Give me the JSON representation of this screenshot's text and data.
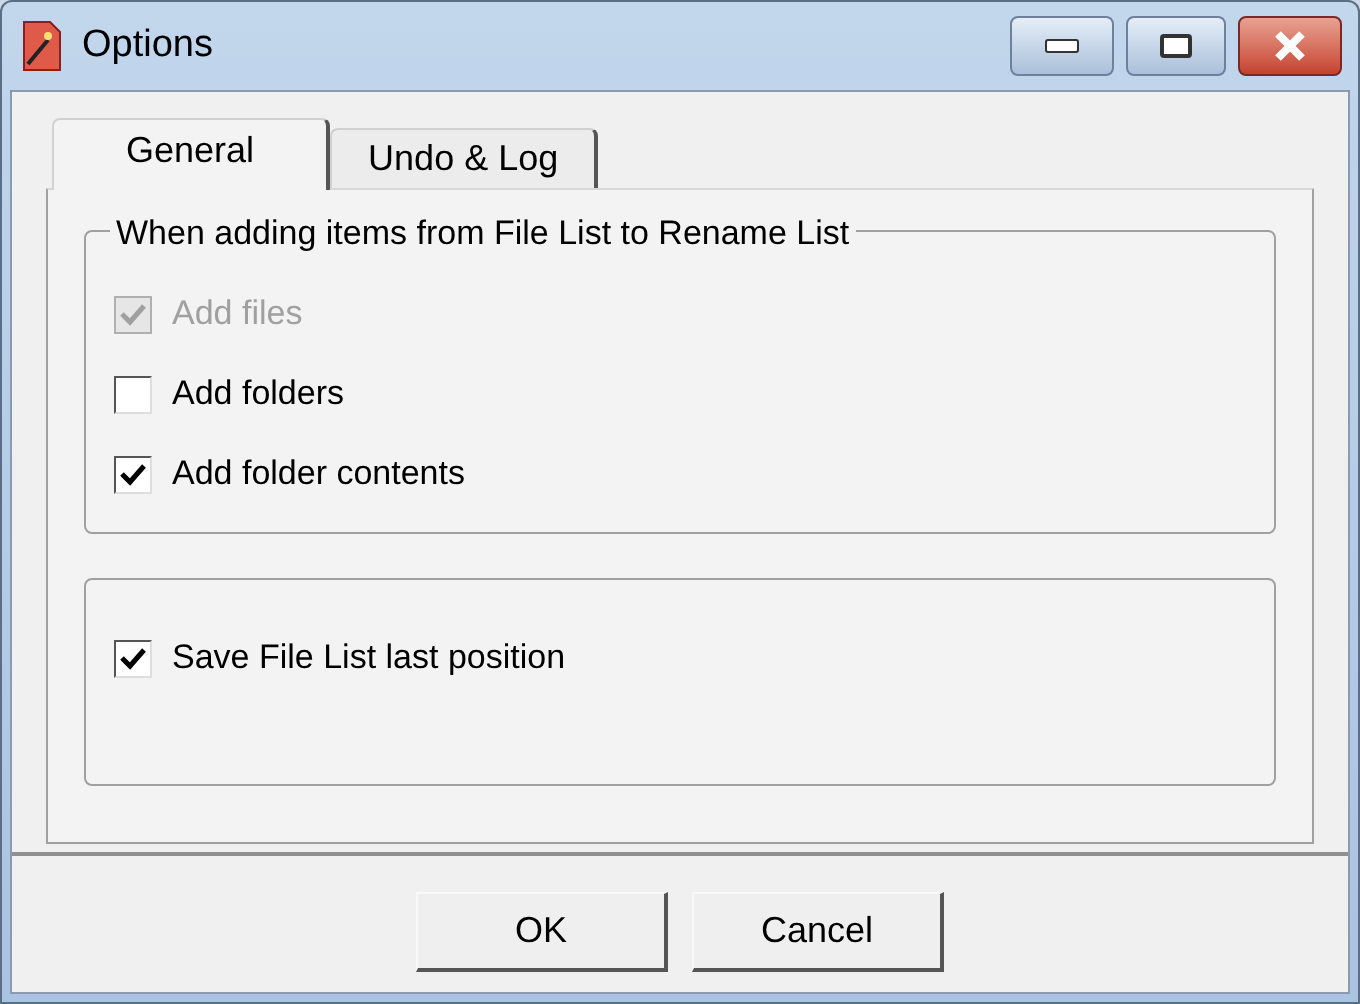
{
  "window": {
    "title": "Options"
  },
  "tabs": [
    {
      "label": "General",
      "selected": true
    },
    {
      "label": "Undo & Log",
      "selected": false
    }
  ],
  "groups": [
    {
      "title": "When adding items from File List to Rename List",
      "options": [
        {
          "label": "Add files",
          "checked": true,
          "disabled": true
        },
        {
          "label": "Add folders",
          "checked": false,
          "disabled": false
        },
        {
          "label": "Add folder contents",
          "checked": true,
          "disabled": false
        }
      ]
    },
    {
      "options": [
        {
          "label": "Save File List last position",
          "checked": true,
          "disabled": false
        }
      ]
    }
  ],
  "buttons": [
    "OK",
    "Cancel"
  ]
}
